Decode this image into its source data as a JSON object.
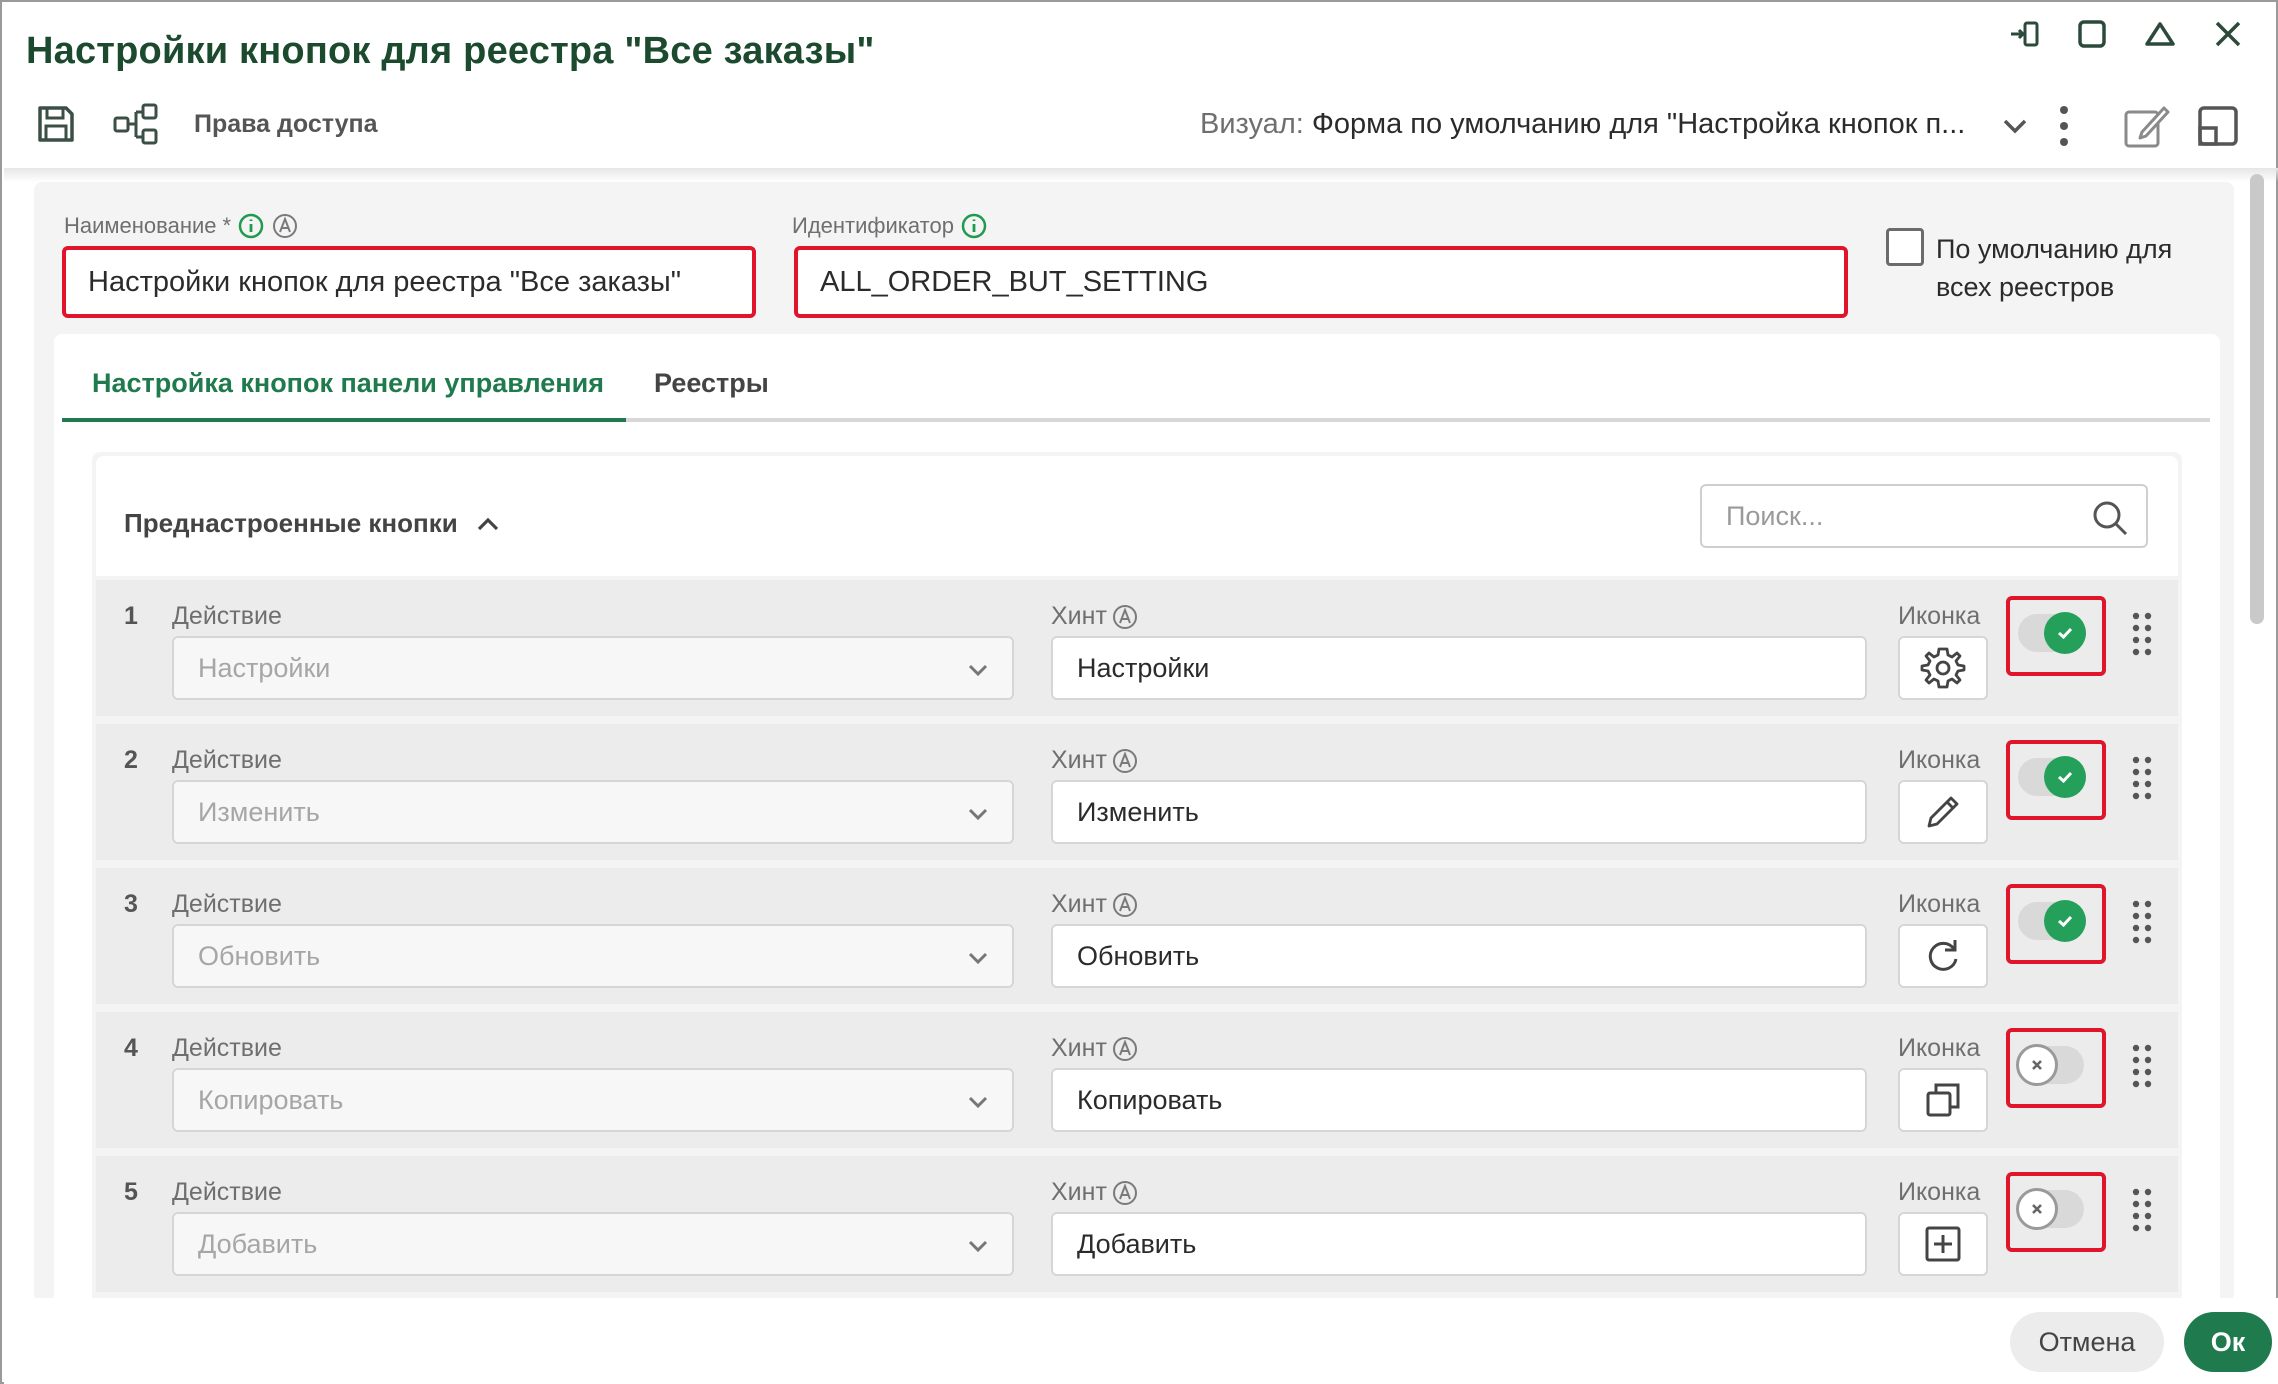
{
  "window": {
    "title": "Настройки кнопок для реестра \"Все заказы\"",
    "controls": [
      "pin-icon",
      "maximize-icon",
      "collapse-icon",
      "close-icon"
    ]
  },
  "toolbar": {
    "save_icon": "save-icon",
    "share_icon": "share-icon",
    "access_rights": "Права доступа",
    "visual_label": "Визуал:",
    "visual_value": "Форма по умолчанию для \"Настройка кнопок п...",
    "edit_icon": "edit-form-icon",
    "layout_icon": "side-panel-icon"
  },
  "form": {
    "name_label": "Наименование",
    "name_required": "*",
    "name_value": "Настройки кнопок для реестра \"Все заказы\"",
    "id_label": "Идентификатор",
    "id_value": "ALL_ORDER_BUT_SETTING",
    "default_checkbox": {
      "checked": false,
      "label_line1": "По умолчанию для",
      "label_line2": "всех реестров"
    }
  },
  "tabs": [
    {
      "label": "Настройка кнопок панели управления",
      "active": true
    },
    {
      "label": "Реестры",
      "active": false
    }
  ],
  "section": {
    "title": "Преднастроенные кнопки",
    "search_placeholder": "Поиск..."
  },
  "rows": [
    {
      "num": "1",
      "action_label": "Действие",
      "action": "Настройки",
      "hint_label": "Хинт",
      "hint": "Настройки",
      "icon_label": "Иконка",
      "icon": "gear-icon",
      "enabled": true
    },
    {
      "num": "2",
      "action_label": "Действие",
      "action": "Изменить",
      "hint_label": "Хинт",
      "hint": "Изменить",
      "icon_label": "Иконка",
      "icon": "pencil-icon",
      "enabled": true
    },
    {
      "num": "3",
      "action_label": "Действие",
      "action": "Обновить",
      "hint_label": "Хинт",
      "hint": "Обновить",
      "icon_label": "Иконка",
      "icon": "refresh-icon",
      "enabled": true
    },
    {
      "num": "4",
      "action_label": "Действие",
      "action": "Копировать",
      "hint_label": "Хинт",
      "hint": "Копировать",
      "icon_label": "Иконка",
      "icon": "copy-icon",
      "enabled": false
    },
    {
      "num": "5",
      "action_label": "Действие",
      "action": "Добавить",
      "hint_label": "Хинт",
      "hint": "Добавить",
      "icon_label": "Иконка",
      "icon": "plus-square-icon",
      "enabled": false
    }
  ],
  "footer": {
    "cancel": "Отмена",
    "ok": "Ок"
  },
  "colors": {
    "title": "#1b4a2e",
    "accent": "#1f7a4d",
    "toggle_on": "#24a05b",
    "highlight": "#e0142b"
  }
}
